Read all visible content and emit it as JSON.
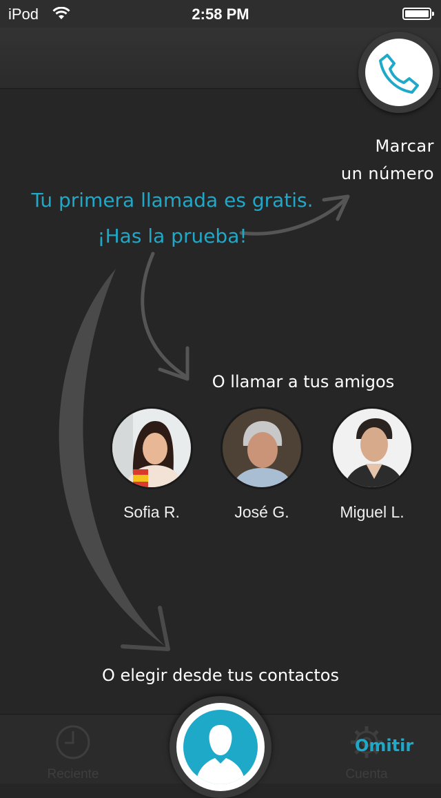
{
  "status_bar": {
    "carrier": "iPod",
    "time": "2:58 PM"
  },
  "dial": {
    "line1": "Marcar",
    "line2": "un número"
  },
  "promo": {
    "line1": "Tu primera llamada es gratis.",
    "line2": "¡Has la prueba!"
  },
  "friends": {
    "title": "O llamar a tus amigos",
    "items": [
      {
        "name": "Sofia R."
      },
      {
        "name": "José G."
      },
      {
        "name": "Miguel L."
      }
    ]
  },
  "contacts": {
    "title": "O elegir desde tus contactos"
  },
  "tab_bar": {
    "recent_label": "Reciente",
    "account_label": "Cuenta",
    "skip_label": "Omitir"
  },
  "colors": {
    "accent": "#1fa9c9",
    "background": "#262626"
  }
}
